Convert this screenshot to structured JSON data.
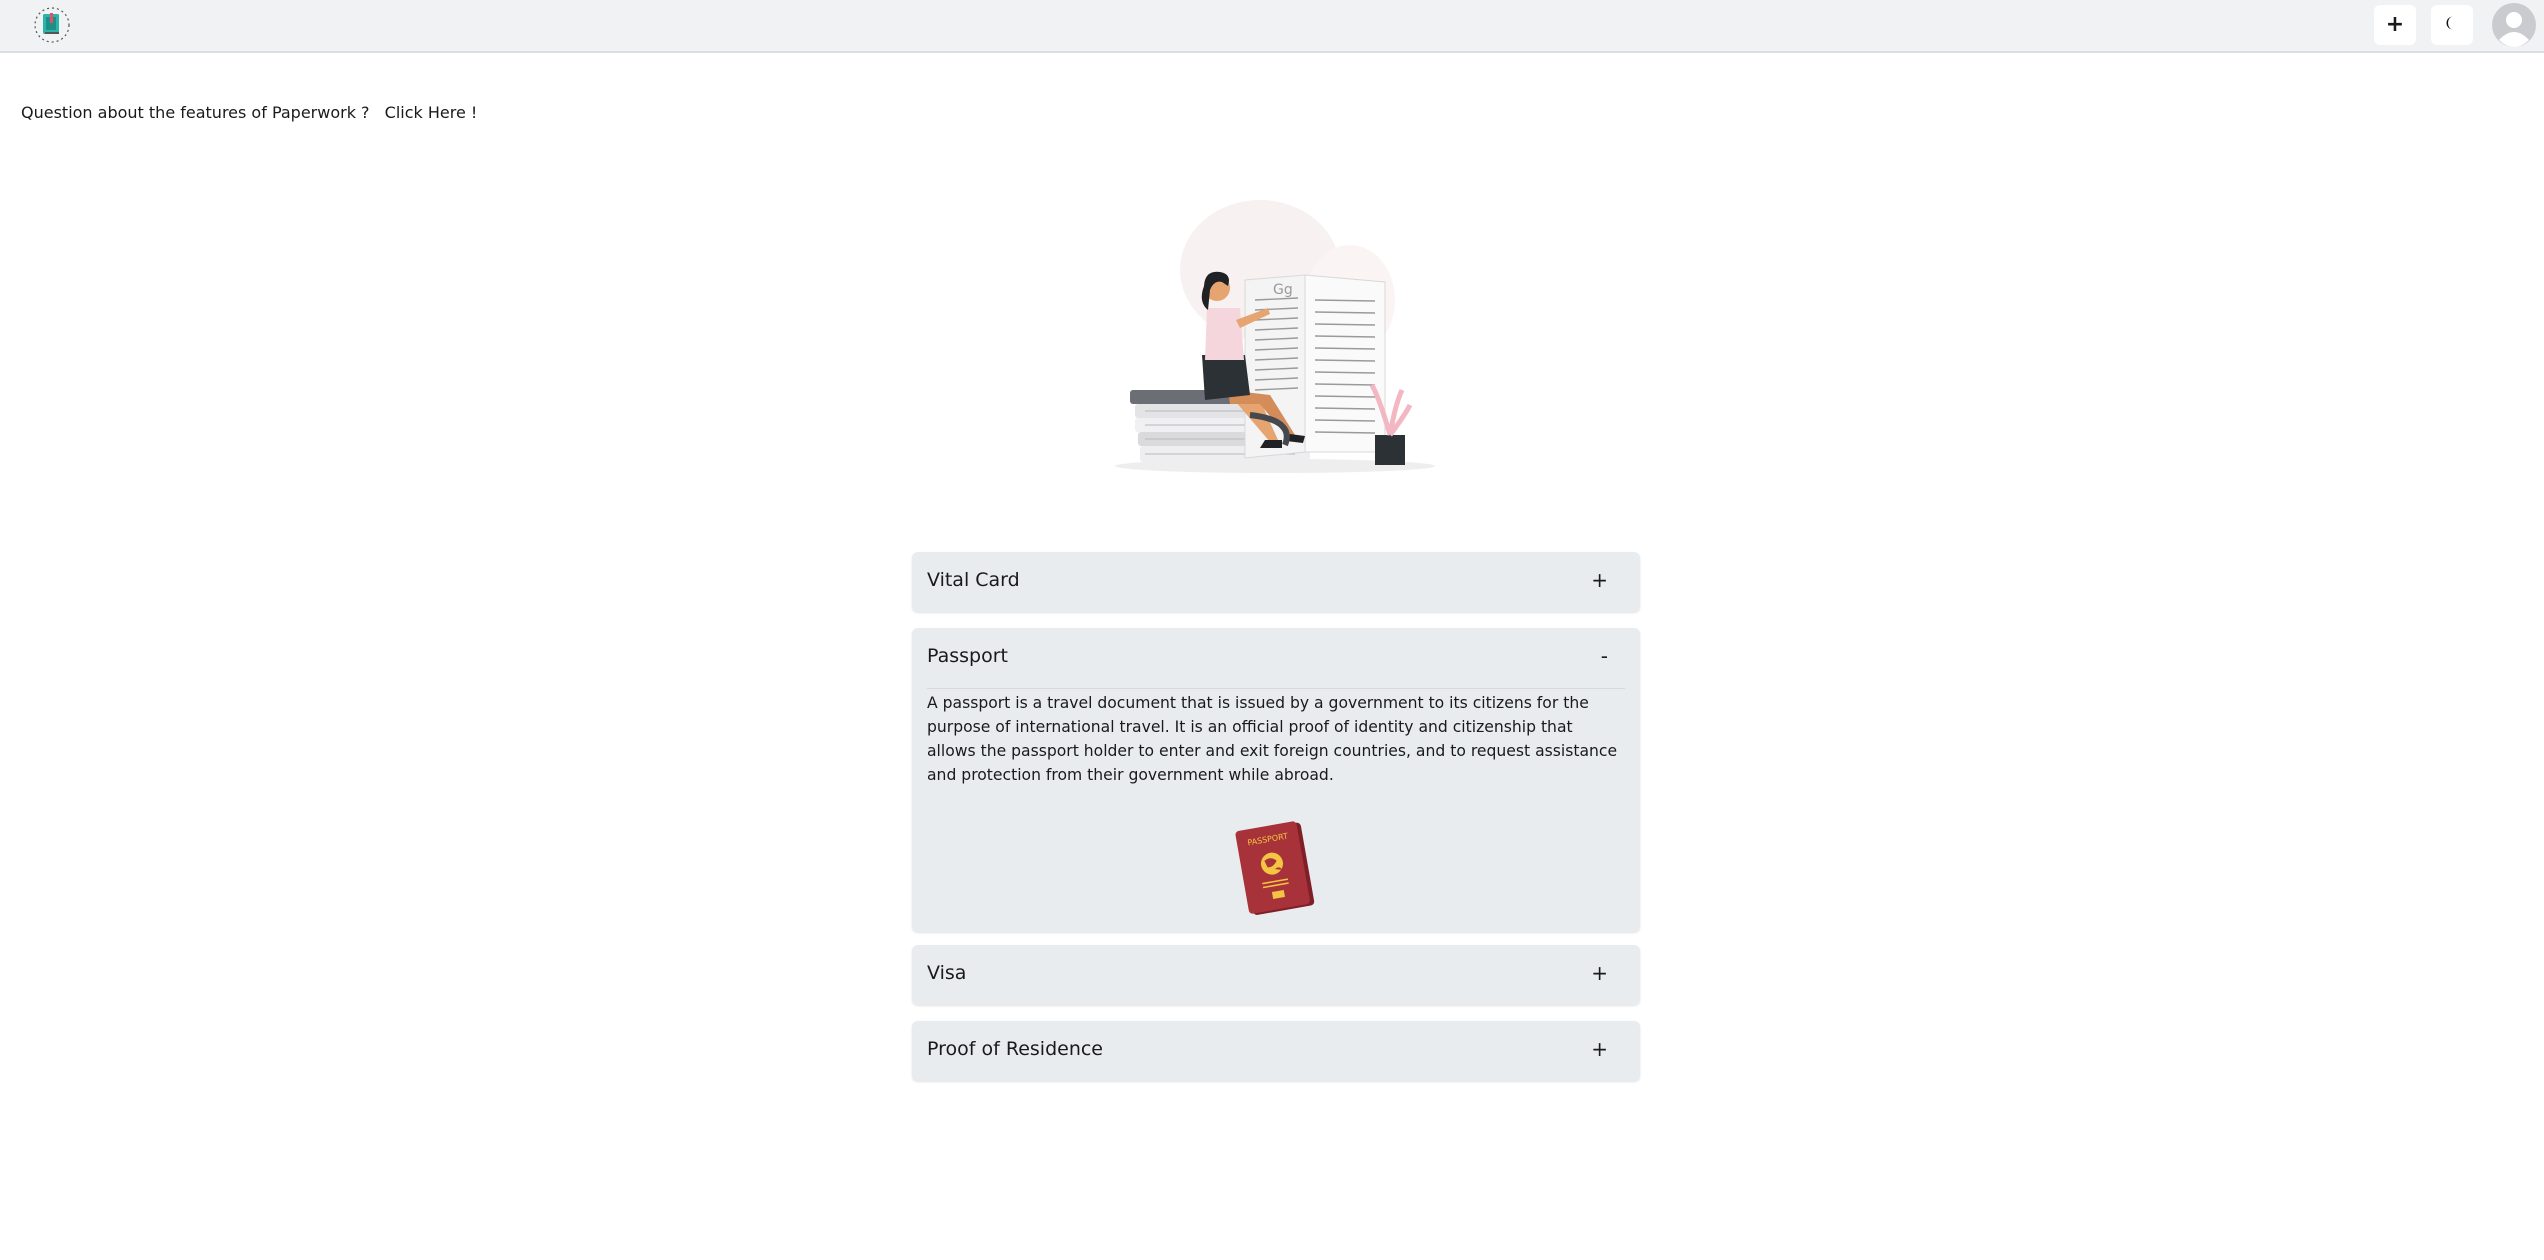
{
  "header": {
    "logo_icon": "paperwork-logo-icon",
    "add_label": "+",
    "theme_icon": "moon-icon",
    "avatar_icon": "user-avatar-icon"
  },
  "question": {
    "text": "Question about the features of Paperwork ?",
    "link": "Click Here !"
  },
  "hero": {
    "illustration": "woman-reading-book-illustration"
  },
  "accordion": [
    {
      "title": "Vital Card",
      "toggle": "+",
      "expanded": false
    },
    {
      "title": "Passport",
      "toggle": "-",
      "expanded": true,
      "body": "A passport is a travel document that is issued by a government to its citizens for the purpose of international travel. It is an official proof of identity and citizenship that allows the passport holder to enter and exit foreign countries, and to request assistance and protection from their government while abroad.",
      "image_label": "PASSPORT"
    },
    {
      "title": "Visa",
      "toggle": "+",
      "expanded": false
    },
    {
      "title": "Proof of Residence",
      "toggle": "+",
      "expanded": false
    }
  ],
  "colors": {
    "topbar_bg": "#f1f2f3",
    "accordion_bg": "#e9ecef",
    "passport_red": "#a8323a",
    "accent_teal": "#2bb5a8"
  }
}
